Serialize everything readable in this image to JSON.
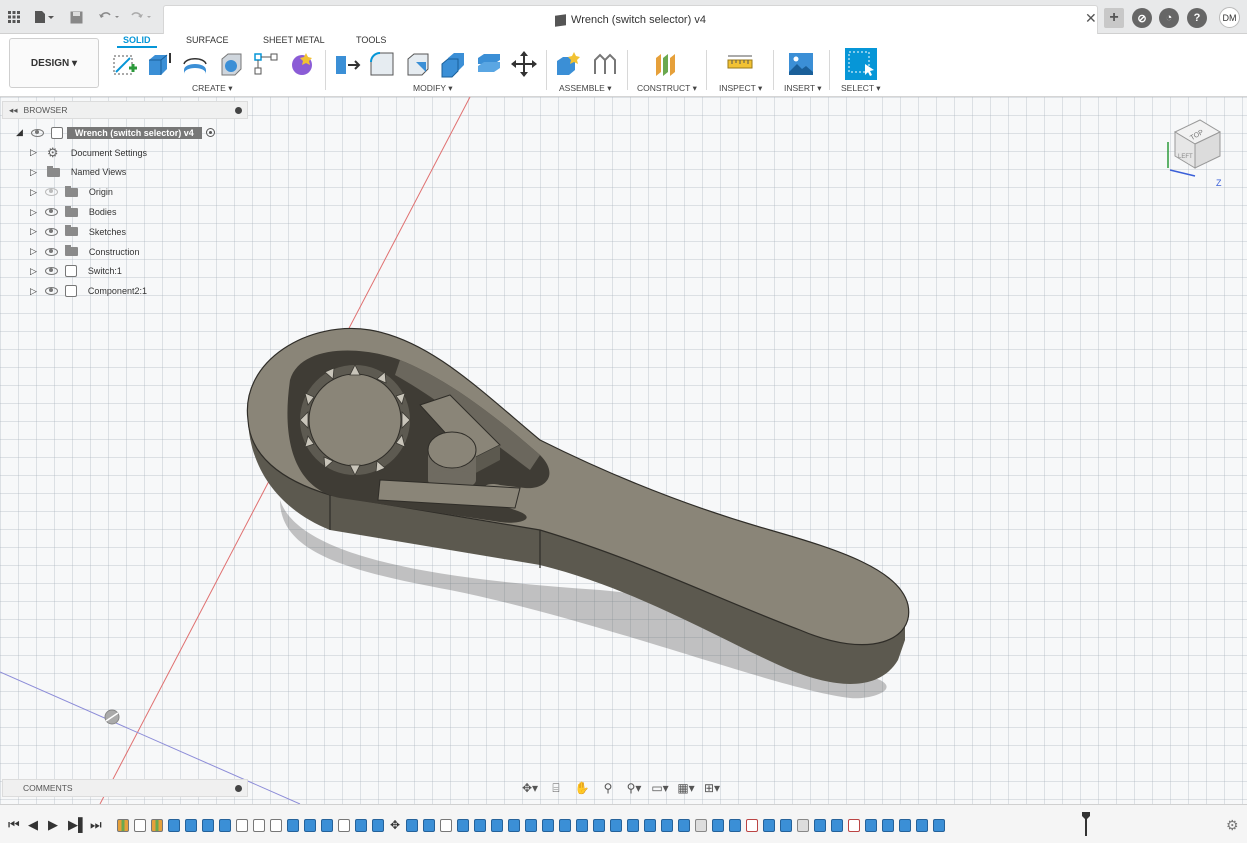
{
  "window": {
    "title": "Wrench (switch selector) v4",
    "user_initials": "DM"
  },
  "toolbar": {
    "workspace": "DESIGN",
    "tabs": [
      "SOLID",
      "SURFACE",
      "SHEET METAL",
      "TOOLS"
    ],
    "active_tab": "SOLID",
    "groups": [
      "CREATE",
      "MODIFY",
      "ASSEMBLE",
      "CONSTRUCT",
      "INSPECT",
      "INSERT",
      "SELECT"
    ]
  },
  "browser": {
    "title": "BROWSER",
    "root": "Wrench (switch selector) v4",
    "items": [
      {
        "label": "Document Settings",
        "icon": "gear-icon"
      },
      {
        "label": "Named Views",
        "icon": "folder-icon"
      },
      {
        "label": "Origin",
        "icon": "folder-icon"
      },
      {
        "label": "Bodies",
        "icon": "folder-icon"
      },
      {
        "label": "Sketches",
        "icon": "folder-icon"
      },
      {
        "label": "Construction",
        "icon": "folder-icon"
      },
      {
        "label": "Switch:1",
        "icon": "component-icon"
      },
      {
        "label": "Component2:1",
        "icon": "component-icon"
      }
    ]
  },
  "comments": {
    "title": "COMMENTS"
  },
  "viewcube": {
    "face_top": "TOP",
    "face_left": "LEFT",
    "axis_z": "Z"
  },
  "colors": {
    "accent": "#0696d7",
    "model": "#8a8578"
  }
}
